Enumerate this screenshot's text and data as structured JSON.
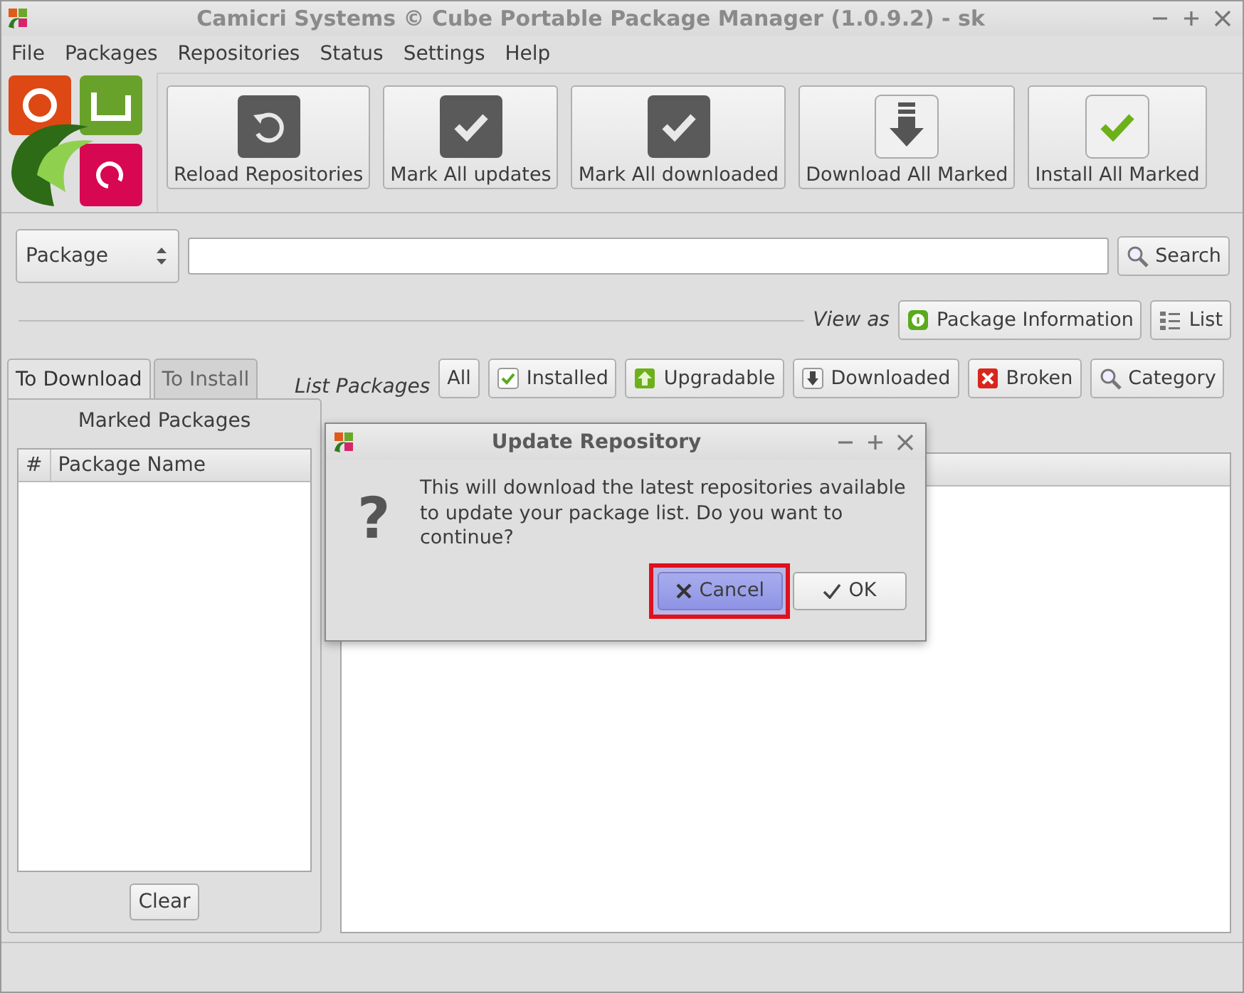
{
  "window": {
    "title": "Camicri Systems © Cube Portable Package Manager (1.0.9.2) - sk"
  },
  "menu": [
    "File",
    "Packages",
    "Repositories",
    "Status",
    "Settings",
    "Help"
  ],
  "toolbar": [
    {
      "label": "Reload Repositories",
      "kind": "reload"
    },
    {
      "label": "Mark All updates",
      "kind": "check"
    },
    {
      "label": "Mark All downloaded",
      "kind": "check"
    },
    {
      "label": "Download All Marked",
      "kind": "download"
    },
    {
      "label": "Install All Marked",
      "kind": "install"
    }
  ],
  "search": {
    "scope": "Package",
    "button": "Search"
  },
  "view": {
    "label": "View as",
    "buttons": [
      {
        "label": "Package Information",
        "kind": "info"
      },
      {
        "label": "List",
        "kind": "list"
      }
    ]
  },
  "tabs": [
    {
      "label": "To Download",
      "selected": true
    },
    {
      "label": "To Install",
      "selected": false
    }
  ],
  "filters": {
    "label": "List Packages",
    "buttons": [
      {
        "label": "All",
        "kind": "plain"
      },
      {
        "label": "Installed",
        "kind": "installed"
      },
      {
        "label": "Upgradable",
        "kind": "upgradable"
      },
      {
        "label": "Downloaded",
        "kind": "downloaded"
      },
      {
        "label": "Broken",
        "kind": "broken"
      },
      {
        "label": "Category",
        "kind": "search"
      }
    ]
  },
  "marked": {
    "title": "Marked Packages",
    "columns": [
      "#",
      "Package Name"
    ],
    "button": "Clear"
  },
  "dialog": {
    "title": "Update Repository",
    "symbol": "?",
    "message": "This will download the latest repositories available to update your package list. Do you want to continue?",
    "buttons": [
      {
        "label": "Cancel",
        "kind": "cancel",
        "highlighted": true
      },
      {
        "label": "OK",
        "kind": "ok",
        "highlighted": false
      }
    ]
  }
}
